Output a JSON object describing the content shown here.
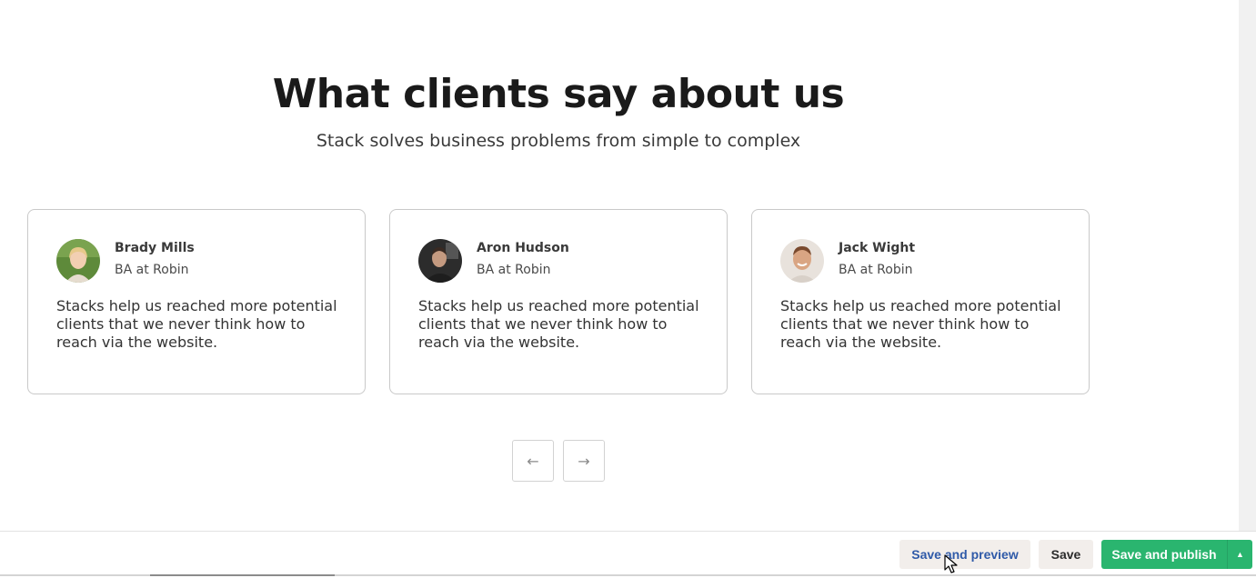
{
  "section": {
    "title": "What clients say about us",
    "subtitle": "Stack solves business problems from simple to complex"
  },
  "testimonials": [
    {
      "name": "Brady Mills",
      "role": "BA at Robin",
      "quote": "Stacks help us reached more potential clients that we never think how to reach via the website.",
      "avatar_icon": "avatar-photo-icon"
    },
    {
      "name": "Aron Hudson",
      "role": "BA at Robin",
      "quote": "Stacks help us reached more potential clients that we never think how to reach via the website.",
      "avatar_icon": "avatar-photo-icon"
    },
    {
      "name": "Jack Wight",
      "role": "BA at Robin",
      "quote": "Stacks help us reached more potential clients that we never think how to reach via the website.",
      "avatar_icon": "avatar-photo-icon"
    }
  ],
  "carousel": {
    "prev_glyph": "←",
    "next_glyph": "→"
  },
  "toolbar": {
    "save_preview_label": "Save and preview",
    "save_label": "Save",
    "publish_label": "Save and publish",
    "publish_menu_glyph": "▲"
  },
  "colors": {
    "publish": "#2ab56f",
    "preview_text": "#2f5aa8",
    "secondary_bg": "#f2eeeb"
  }
}
